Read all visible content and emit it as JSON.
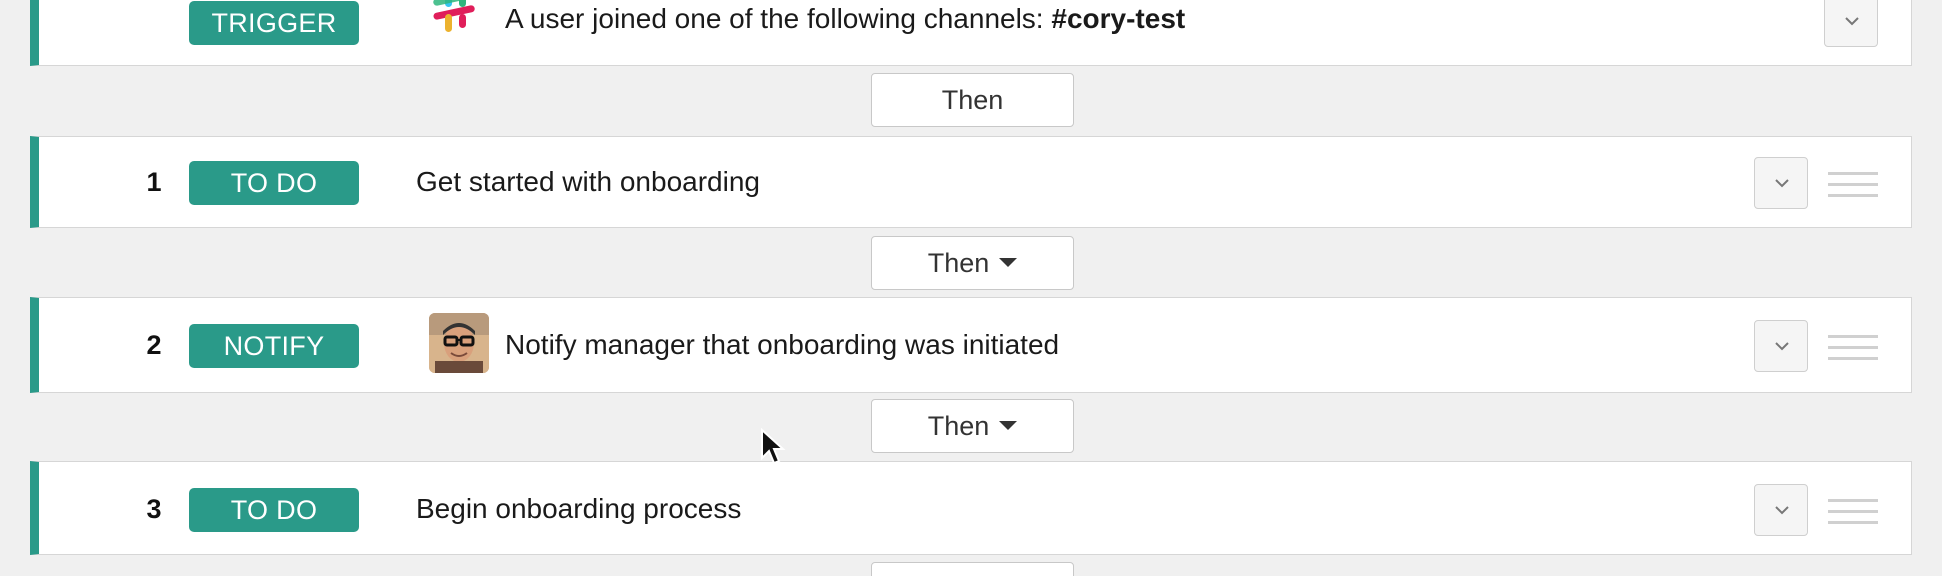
{
  "trigger_row": {
    "badge": "TRIGGER",
    "text_prefix": "A user joined one of the following channels: ",
    "channel": "#cory-test",
    "icon": "slack-icon"
  },
  "connectors": {
    "then_1": "Then",
    "then_2": "Then",
    "then_3": "Then"
  },
  "steps": [
    {
      "number": "1",
      "badge": "TO DO",
      "text": "Get started with onboarding"
    },
    {
      "number": "2",
      "badge": "NOTIFY",
      "text": "Notify manager that onboarding was initiated",
      "icon": "user-avatar"
    },
    {
      "number": "3",
      "badge": "TO DO",
      "text": "Begin onboarding process"
    }
  ],
  "colors": {
    "accent": "#2a9a89",
    "background": "#f0f0f0",
    "row_background": "#ffffff",
    "border": "#d6d6d6"
  }
}
